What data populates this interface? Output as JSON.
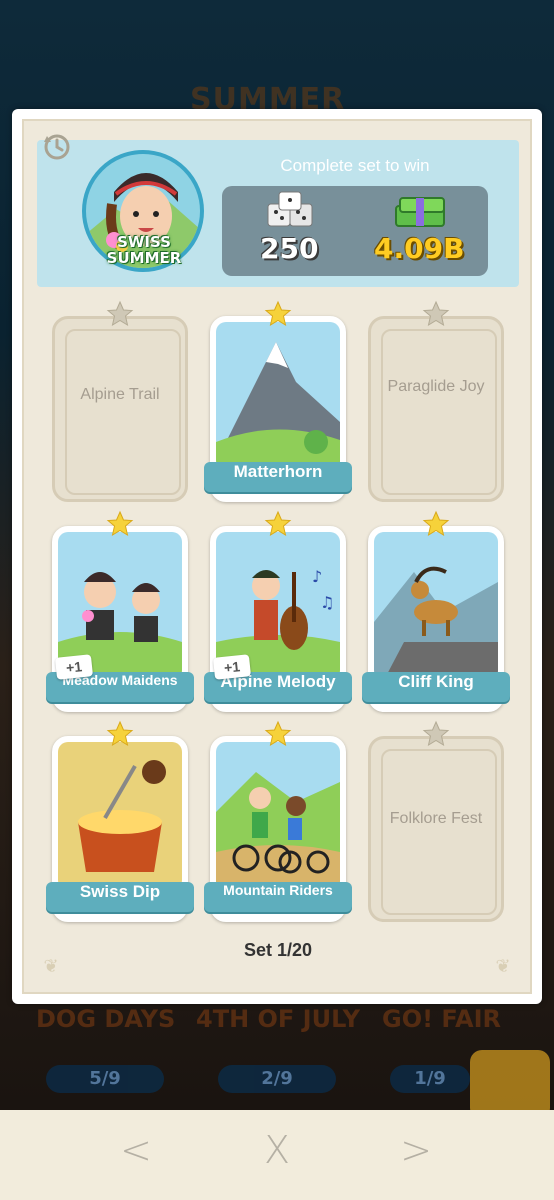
{
  "background": {
    "event_title": "SUMMER",
    "sets": [
      {
        "name": "DOG DAYS",
        "progress": "5/9"
      },
      {
        "name": "4TH OF JULY",
        "progress": "2/9"
      },
      {
        "name": "GO! FAIR",
        "progress": "1/9"
      }
    ]
  },
  "header": {
    "album_badge": "SWISS SUMMER",
    "complete_text": "Complete set to win",
    "reward_dice": "250",
    "reward_cash": "4.09B"
  },
  "cards": [
    {
      "label": "Alpine Trail",
      "collected": false
    },
    {
      "label": "Matterhorn",
      "collected": true
    },
    {
      "label": "Paraglide Joy",
      "collected": false
    },
    {
      "label": "Meadow Maidens",
      "collected": true,
      "extra": "+1"
    },
    {
      "label": "Alpine Melody",
      "collected": true,
      "extra": "+1"
    },
    {
      "label": "Cliff King",
      "collected": true
    },
    {
      "label": "Swiss Dip",
      "collected": true
    },
    {
      "label": "Mountain Riders",
      "collected": true
    },
    {
      "label": "Folklore Fest",
      "collected": false
    }
  ],
  "set_label": "Set 1/20",
  "nav": {
    "prev": "<",
    "close": "X",
    "next": ">"
  },
  "colors": {
    "star_gold": "#f6d23a",
    "star_grey": "#cfc8b6",
    "banner": "#5eaebd",
    "header_bg": "#bfe3ec"
  }
}
